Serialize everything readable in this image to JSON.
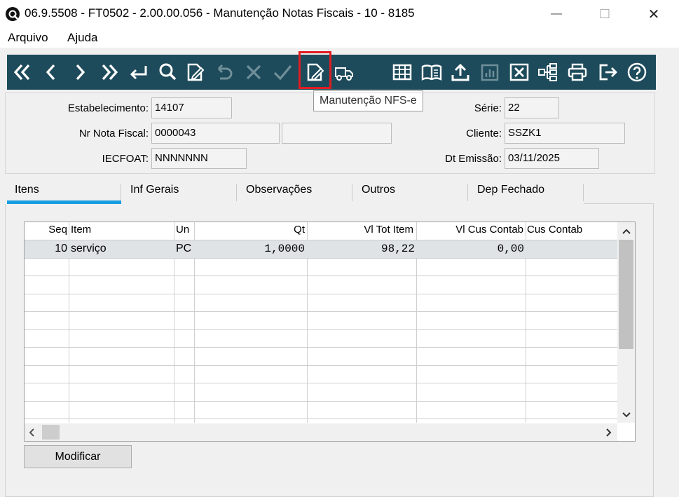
{
  "window": {
    "title": "06.9.5508 - FT0502 - 2.00.00.056 - Manutenção Notas Fiscais - 10 - 8185",
    "controls": {
      "minimize": "—",
      "maximize": "☐",
      "close": "✕"
    }
  },
  "menu": {
    "items": [
      "Arquivo",
      "Ajuda"
    ]
  },
  "toolbar": {
    "tooltip": "Manutenção NFS-e",
    "buttons": [
      "first-icon",
      "previous-icon",
      "next-icon",
      "last-icon",
      "goto-icon",
      "search-icon",
      "edit-icon",
      "undo-icon",
      "cancel-icon",
      "confirm-icon",
      "nfse-icon",
      "delivery-truck-icon",
      "table-icon",
      "book-icon",
      "upload-icon",
      "chart-icon",
      "excel-icon",
      "tree-icon",
      "print-icon",
      "exit-icon",
      "help-icon"
    ],
    "colors": {
      "background": "#1e4b5b",
      "icon": "#ffffff",
      "disabled": "#6f8f99",
      "highlight": "#e01b22"
    }
  },
  "header": {
    "estabelecimento": {
      "label": "Estabelecimento:",
      "value": "14107"
    },
    "nr_nota_fiscal": {
      "label": "Nr Nota Fiscal:",
      "value": "0000043",
      "extra": ""
    },
    "iecfoat": {
      "label": "IECFOAT:",
      "value": "NNNNNNN"
    },
    "serie": {
      "label": "Série:",
      "value": "22"
    },
    "cliente": {
      "label": "Cliente:",
      "value": "SSZK1"
    },
    "dt_emissao": {
      "label": "Dt Emissão:",
      "value": "03/11/2025"
    }
  },
  "tabs": [
    "Itens",
    "Inf Gerais",
    "Observações",
    "Outros",
    "Dep Fechado"
  ],
  "active_tab_color": "#1a9ee3",
  "grid": {
    "columns": [
      "Seq",
      "Item",
      "Un",
      "Qt",
      "Vl Tot Item",
      "Vl Cus Contab",
      "Cus Contab"
    ],
    "rows": [
      {
        "seq": "10",
        "item": "serviço",
        "un": "PC",
        "qt": "1,0000",
        "vl_tot": "98,22",
        "vl_cus": "0,00",
        "cus": ""
      }
    ]
  },
  "buttons": {
    "modificar": "Modificar"
  }
}
